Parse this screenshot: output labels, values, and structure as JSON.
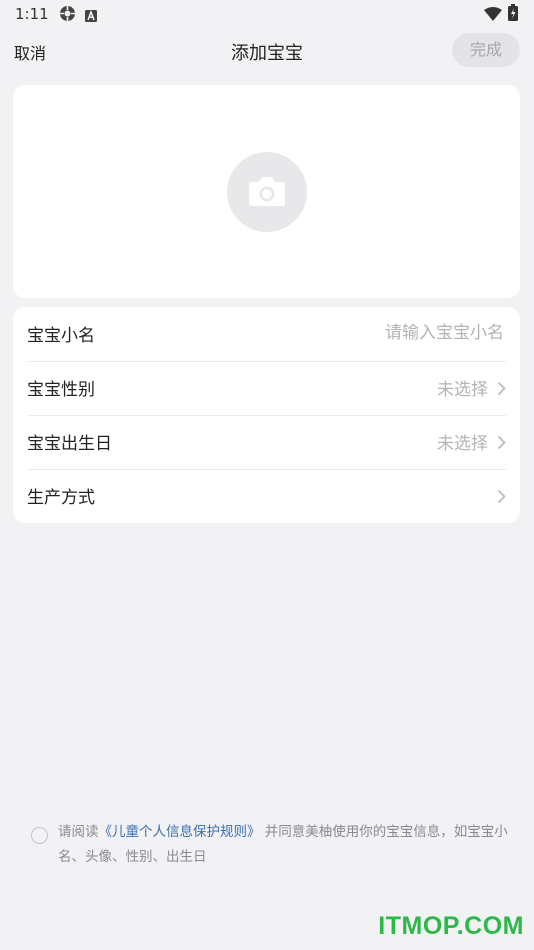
{
  "status_bar": {
    "time": "1:11",
    "icons": [
      "settings-cog-icon",
      "font-a-icon",
      "wifi-icon",
      "battery-icon"
    ]
  },
  "header": {
    "cancel_label": "取消",
    "title": "添加宝宝",
    "done_label": "完成"
  },
  "photo": {
    "icon": "camera-icon"
  },
  "form": {
    "name": {
      "label": "宝宝小名",
      "placeholder": "请输入宝宝小名"
    },
    "gender": {
      "label": "宝宝性别",
      "value": "未选择"
    },
    "birthday": {
      "label": "宝宝出生日",
      "value": "未选择"
    },
    "delivery": {
      "label": "生产方式",
      "value": ""
    }
  },
  "agreement": {
    "prefix": "请阅读",
    "link_text": "《儿童个人信息保护规则》",
    "suffix": "并同意美柚使用你的宝宝信息，如宝宝小名、头像、性别、出生日"
  },
  "watermark": "ITMOP.COM",
  "colors": {
    "background": "#f2f2f5",
    "card": "#ffffff",
    "link": "#3a6fb0",
    "watermark": "#2db84a"
  }
}
